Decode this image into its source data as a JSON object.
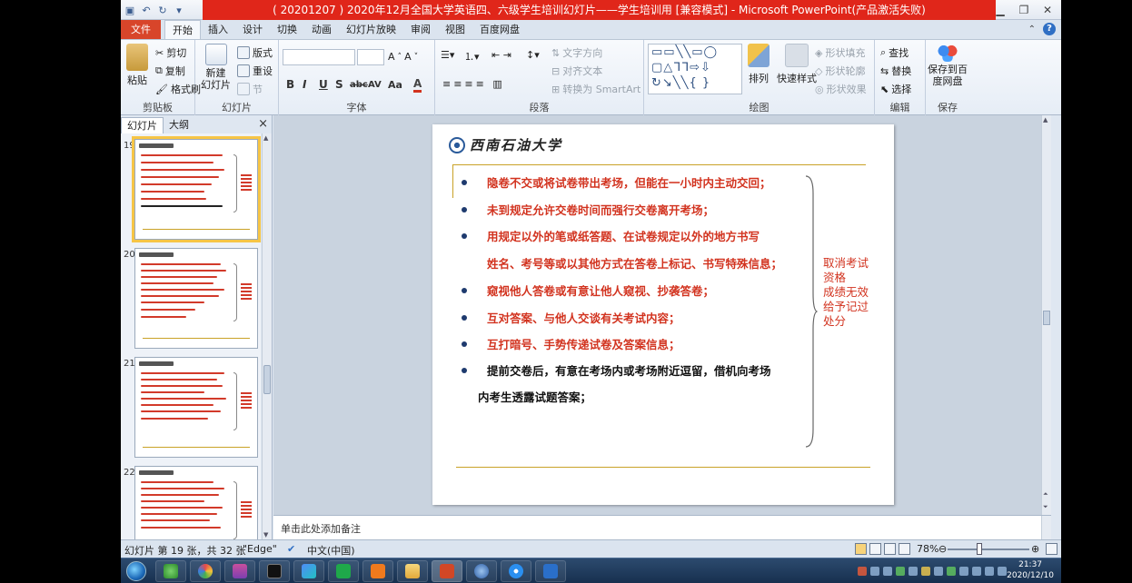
{
  "window": {
    "title": "( 20201207 ) 2020年12月全国大学英语四、六级学生培训幻灯片——学生培训用 [兼容模式]  -  Microsoft PowerPoint(产品激活失败)",
    "controls": [
      "minimize",
      "restore",
      "close"
    ]
  },
  "quick_access": [
    "save-icon",
    "undo-icon",
    "redo-icon",
    "customize-icon"
  ],
  "tabs": [
    {
      "label": "文件"
    },
    {
      "label": "开始"
    },
    {
      "label": "插入"
    },
    {
      "label": "设计"
    },
    {
      "label": "切换"
    },
    {
      "label": "动画"
    },
    {
      "label": "幻灯片放映"
    },
    {
      "label": "审阅"
    },
    {
      "label": "视图"
    },
    {
      "label": "百度网盘"
    }
  ],
  "active_tab": "开始",
  "ribbon": {
    "clipboard": {
      "label": "剪贴板",
      "paste": "粘贴",
      "cut": "剪切",
      "copy": "复制",
      "format_painter": "格式刷"
    },
    "slides": {
      "label": "幻灯片",
      "new_slide": "新建\n幻灯片",
      "layout": "版式",
      "reset": "重设",
      "section": "节"
    },
    "font": {
      "label": "字体",
      "bold": "B",
      "italic": "I",
      "underline": "U",
      "shadow": "S",
      "strike": "abc",
      "spacing": "AV",
      "case": "Aa",
      "color": "A"
    },
    "paragraph": {
      "label": "段落",
      "text_direction": "文字方向",
      "align_text": "对齐文本",
      "smartart": "转换为 SmartArt"
    },
    "drawing": {
      "label": "绘图",
      "arrange": "排列",
      "quick_styles": "快速样式",
      "shape_fill": "形状填充",
      "shape_outline": "形状轮廓",
      "shape_effects": "形状效果"
    },
    "editing": {
      "label": "编辑",
      "find": "查找",
      "replace": "替换",
      "select": "选择"
    },
    "save": {
      "label": "保存",
      "save_to": "保存到百\n度网盘"
    }
  },
  "pane": {
    "tab_slides": "幻灯片",
    "tab_outline": "大纲",
    "close": "×"
  },
  "thumbnails": [
    {
      "num": "19",
      "selected": true
    },
    {
      "num": "20",
      "selected": false
    },
    {
      "num": "21",
      "selected": false
    },
    {
      "num": "22",
      "selected": false
    }
  ],
  "slide": {
    "logo_text": "西南石油大学",
    "bullets": [
      {
        "text": "隐卷不交或将试卷带出考场，但能在一小时内主动交回；",
        "dot": true,
        "color": "red"
      },
      {
        "text": "未到规定允许交卷时间而强行交卷离开考场；",
        "dot": true,
        "color": "red"
      },
      {
        "text": "用规定以外的笔或纸答题、在试卷规定以外的地方书写",
        "dot": true,
        "color": "red"
      },
      {
        "text": "姓名、考号等或以其他方式在答卷上标记、书写特殊信息；",
        "dot": false,
        "color": "red"
      },
      {
        "text": "窥视他人答卷或有意让他人窥视、抄袭答卷；",
        "dot": true,
        "color": "red"
      },
      {
        "text": "互对答案、与他人交谈有关考试内容；",
        "dot": true,
        "color": "red"
      },
      {
        "text": "互打暗号、手势传递试卷及答案信息；",
        "dot": true,
        "color": "red"
      },
      {
        "text": "提前交卷后，有意在考场内或考场附近逗留，借机向考场",
        "dot": true,
        "color": "black"
      },
      {
        "text": "内考生透露试题答案；",
        "dot": false,
        "color": "black"
      }
    ],
    "side_note": "取消考试资格\n成绩无效\n给予记过处分"
  },
  "notes_placeholder": "单击此处添加备注",
  "status": {
    "slide_info": "幻灯片 第 19 张，共 32 张",
    "theme": "\"Edge\"",
    "language": "中文(中国)",
    "zoom": "78%"
  },
  "taskbar": {
    "time": "21:37",
    "date": "2020/12/10",
    "apps": [
      "start-button",
      "ie-icon",
      "app-icon",
      "image-viewer-icon",
      "terminal-icon",
      "feishu-icon",
      "green-app-icon",
      "foxit-icon",
      "folder-icon",
      "powerpoint-icon",
      "media-icon",
      "browser-icon",
      "tool-icon"
    ]
  },
  "colors": {
    "title_bar": "#e0261a",
    "bullet_red": "#d2331f",
    "gold_line": "#c9a227",
    "file_tab": "#d8452a"
  }
}
